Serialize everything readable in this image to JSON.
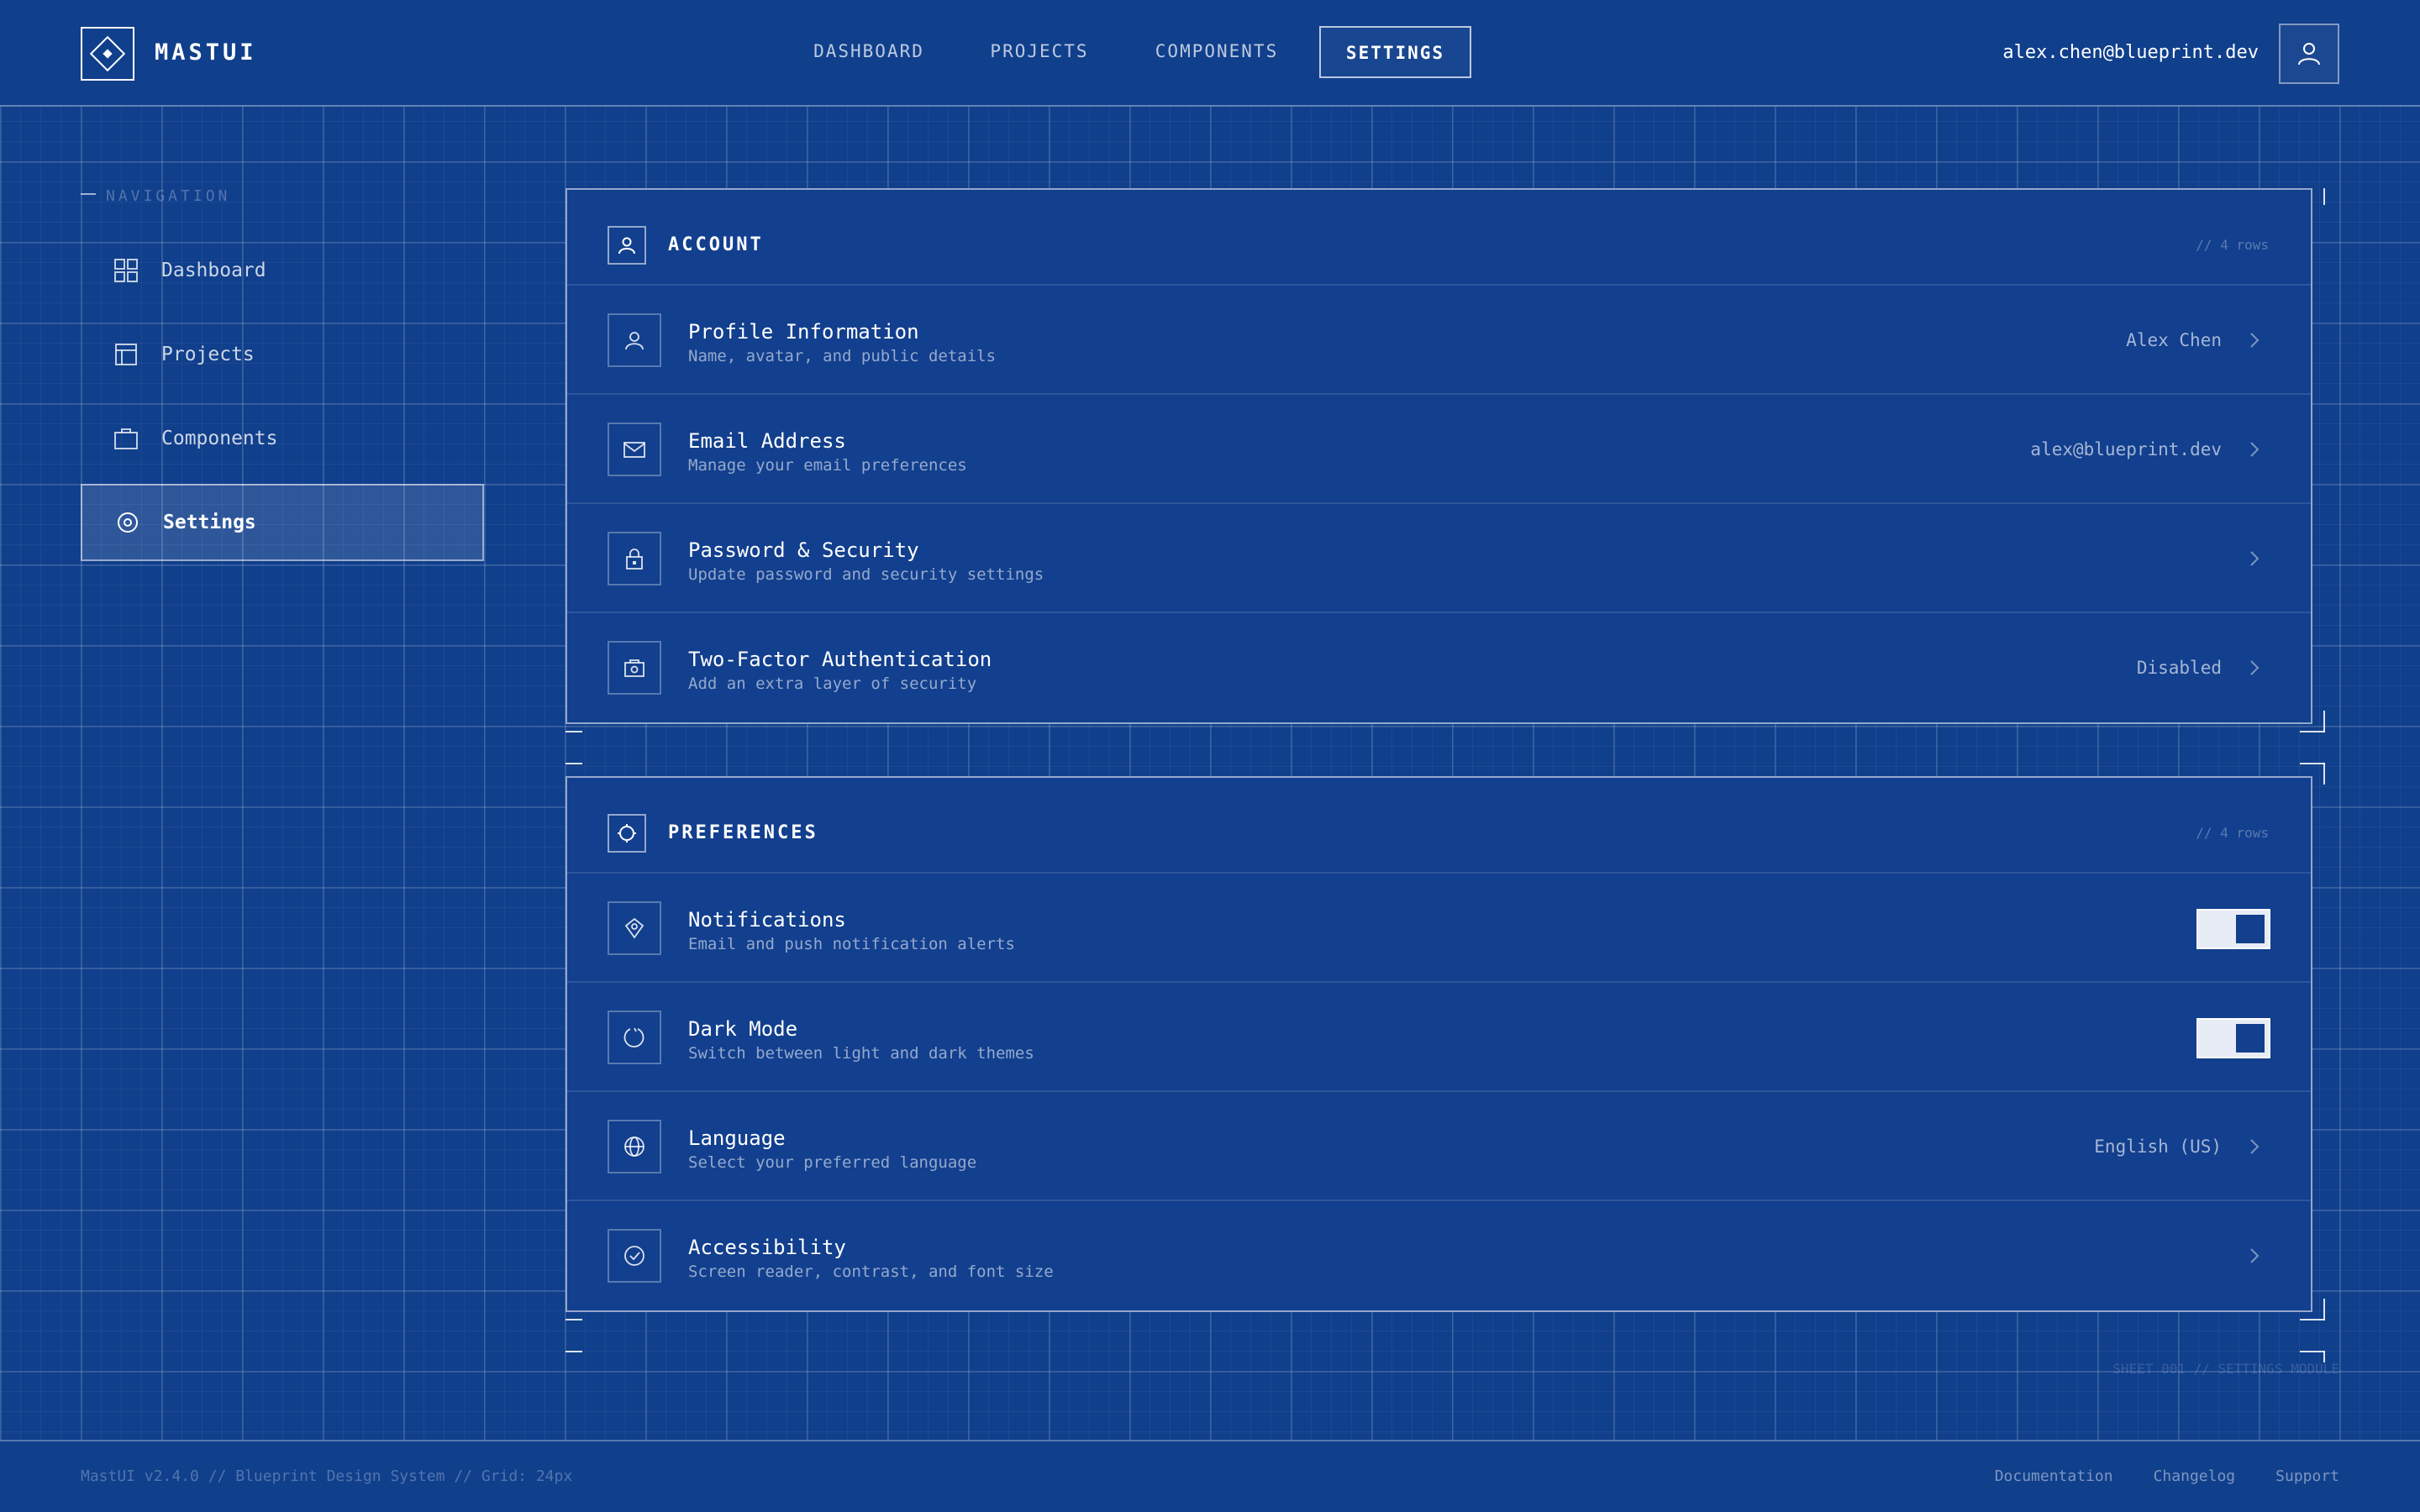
{
  "brand": {
    "name": "MASTUI",
    "logo_icon": "diamond-logo-icon"
  },
  "topnav": {
    "items": [
      {
        "label": "DASHBOARD",
        "active": false
      },
      {
        "label": "PROJECTS",
        "active": false
      },
      {
        "label": "COMPONENTS",
        "active": false
      },
      {
        "label": "SETTINGS",
        "active": true
      }
    ]
  },
  "user": {
    "email": "alex.chen@blueprint.dev",
    "avatar_icon": "user-icon"
  },
  "sidebar": {
    "heading": "NAVIGATION",
    "items": [
      {
        "label": "Dashboard",
        "icon": "grid-icon",
        "active": false
      },
      {
        "label": "Projects",
        "icon": "layout-icon",
        "active": false
      },
      {
        "label": "Components",
        "icon": "box-icon",
        "active": false
      },
      {
        "label": "Settings",
        "icon": "gear-icon",
        "active": true
      }
    ]
  },
  "account": {
    "title": "ACCOUNT",
    "meta": "// 4 rows",
    "icon": "user-icon",
    "rows": [
      {
        "title": "Profile Information",
        "desc": "Name, avatar, and public details",
        "value": "Alex Chen",
        "icon": "user-icon"
      },
      {
        "title": "Email Address",
        "desc": "Manage your email preferences",
        "value": "alex@blueprint.dev",
        "icon": "mail-icon"
      },
      {
        "title": "Password & Security",
        "desc": "Update password and security settings",
        "value": "",
        "icon": "lock-icon"
      },
      {
        "title": "Two-Factor Authentication",
        "desc": "Add an extra layer of security",
        "value": "Disabled",
        "icon": "shield-icon"
      }
    ]
  },
  "preferences": {
    "title": "PREFERENCES",
    "meta": "// 4 rows",
    "icon": "sliders-icon",
    "rows": [
      {
        "title": "Notifications",
        "desc": "Email and push notification alerts",
        "toggle_on": true,
        "icon": "bell-icon"
      },
      {
        "title": "Dark Mode",
        "desc": "Switch between light and dark themes",
        "toggle_on": true,
        "icon": "moon-icon"
      },
      {
        "title": "Language",
        "desc": "Select your preferred language",
        "value": "English (US)",
        "icon": "globe-icon"
      },
      {
        "title": "Accessibility",
        "desc": "Screen reader, contrast, and font size",
        "value": "",
        "icon": "check-circle-icon"
      }
    ]
  },
  "canvas_label": "SHEET 001 // SETTINGS MODULE",
  "footer": {
    "left": "MastUI v2.4.0 // Blueprint Design System // Grid: 24px",
    "links": [
      "Documentation",
      "Changelog",
      "Support"
    ]
  },
  "colors": {
    "background": "#103f8c",
    "panel": "#123f8e",
    "line": "#ffffff",
    "toggle_track": "#e7ecf6"
  }
}
